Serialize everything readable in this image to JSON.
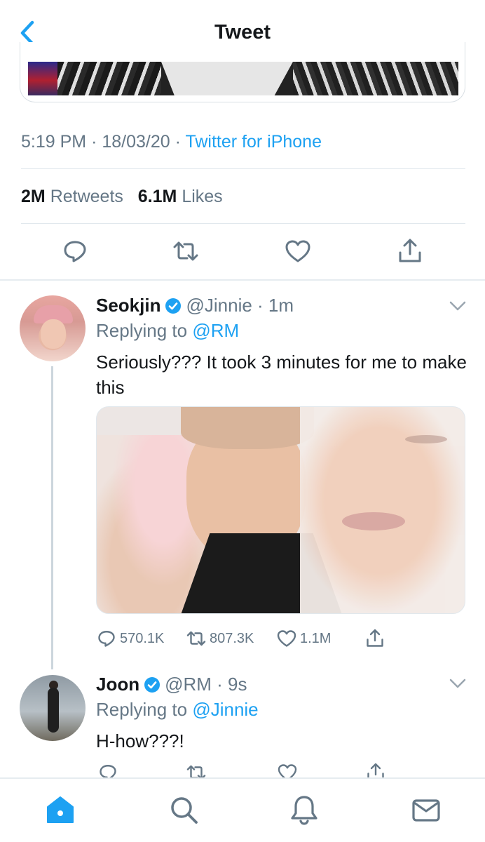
{
  "header": {
    "title": "Tweet"
  },
  "focused_tweet": {
    "time": "5:19 PM",
    "date": "18/03/20",
    "source": "Twitter for iPhone",
    "retweets_count": "2M",
    "retweets_label": "Retweets",
    "likes_count": "6.1M",
    "likes_label": "Likes"
  },
  "replies": [
    {
      "name": "Seokjin",
      "handle": "@Jinnie",
      "time": "1m",
      "replying_label": "Replying to",
      "replying_to": "@RM",
      "text": "Seriously??? It took 3 minutes for me to make this",
      "reply_count": "570.1K",
      "retweet_count": "807.3K",
      "like_count": "1.1M"
    },
    {
      "name": "Joon",
      "handle": "@RM",
      "time": "9s",
      "replying_label": "Replying to",
      "replying_to": "@Jinnie",
      "text": "H-how???!"
    }
  ],
  "colors": {
    "accent": "#1da1f2",
    "secondary_text": "#657786",
    "divider": "#e6ecf0"
  },
  "icons": {
    "back": "chevron-left-icon",
    "reply": "reply-icon",
    "retweet": "retweet-icon",
    "like": "heart-icon",
    "share": "share-icon",
    "verified": "verified-badge-icon",
    "home": "home-icon",
    "search": "search-icon",
    "notifications": "bell-icon",
    "messages": "mail-icon"
  }
}
